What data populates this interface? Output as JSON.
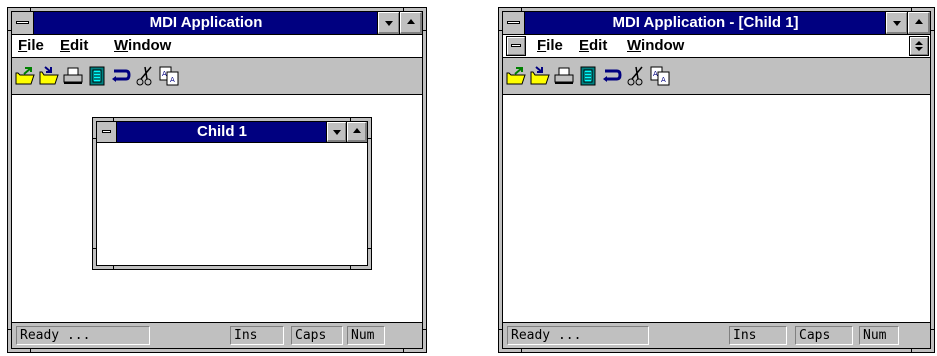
{
  "left_window": {
    "title": "MDI Application",
    "menu": [
      {
        "pre": "",
        "ul": "F",
        "post": "ile"
      },
      {
        "pre": "",
        "ul": "E",
        "post": "dit"
      },
      {
        "pre": "",
        "ul": "W",
        "post": "indow"
      }
    ],
    "child": {
      "title": "Child 1"
    },
    "status": {
      "message": "Ready ...",
      "ins": "Ins",
      "caps": "Caps",
      "num": "Num"
    }
  },
  "right_window": {
    "title": "MDI Application - [Child 1]",
    "menu": [
      {
        "pre": "",
        "ul": "F",
        "post": "ile"
      },
      {
        "pre": "",
        "ul": "E",
        "post": "dit"
      },
      {
        "pre": "",
        "ul": "W",
        "post": "indow"
      }
    ],
    "status": {
      "message": "Ready ...",
      "ins": "Ins",
      "caps": "Caps",
      "num": "Num"
    }
  },
  "toolbar_icons": [
    "new-folder-icon",
    "open-folder-icon",
    "print-icon",
    "document-icon",
    "redo-arrow-icon",
    "cut-scissors-icon",
    "copy-icon"
  ],
  "colors": {
    "titlebar": "#000080",
    "face": "#c0c0c0",
    "client": "#ffffff"
  }
}
